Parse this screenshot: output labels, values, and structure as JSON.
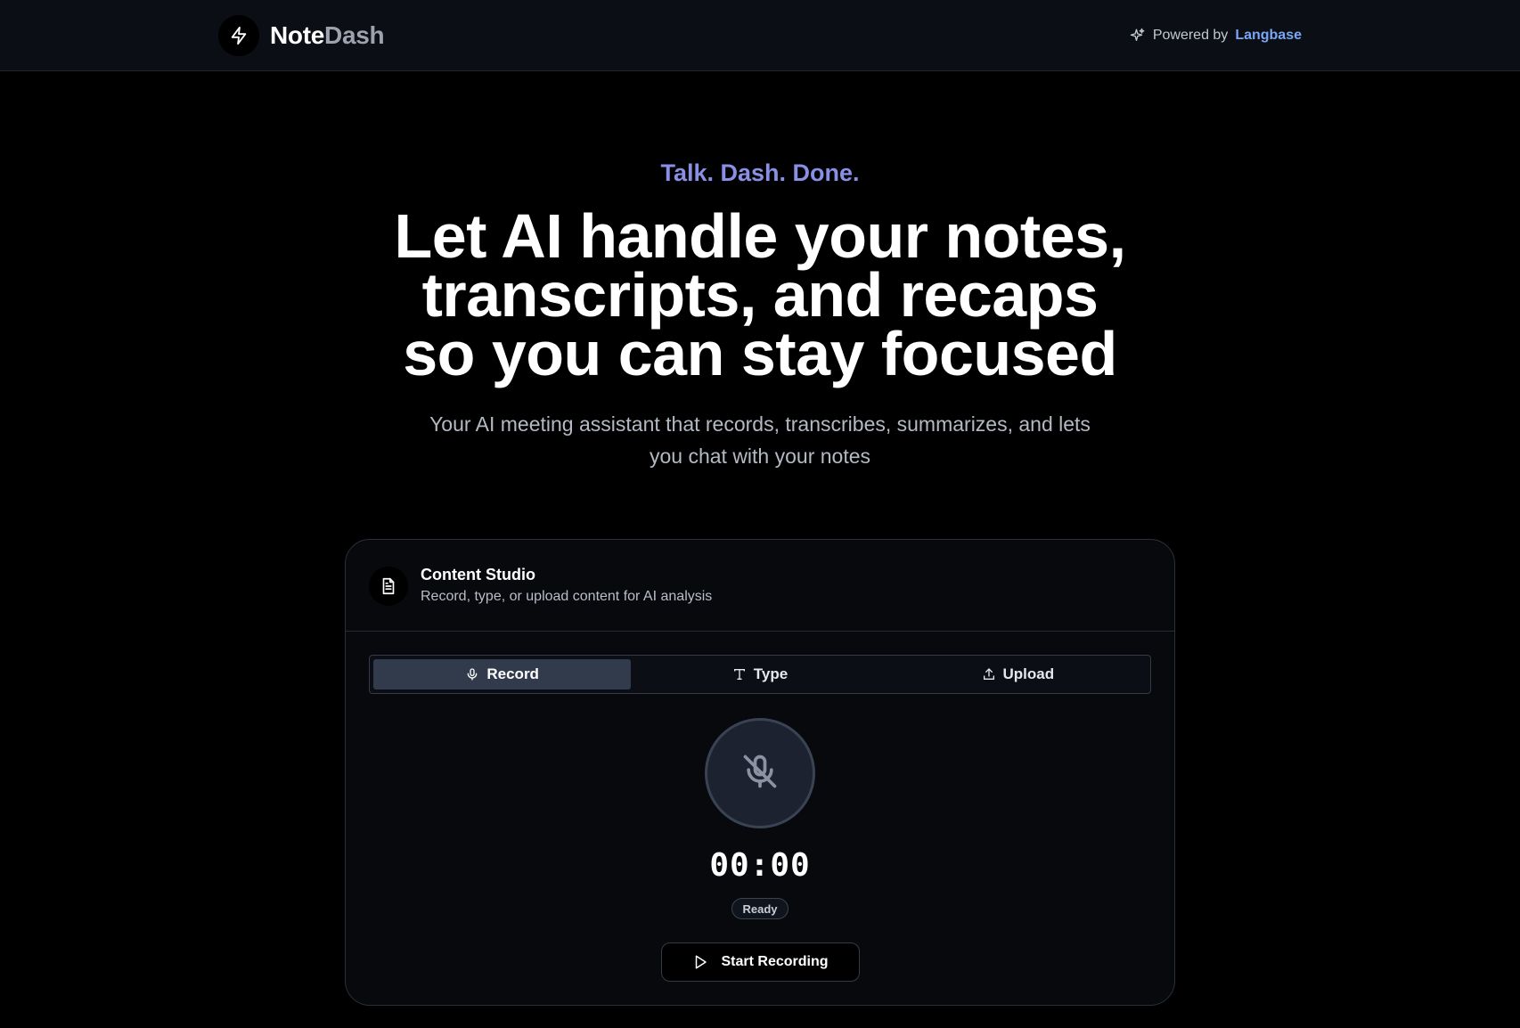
{
  "header": {
    "brand_primary": "Note",
    "brand_secondary": "Dash",
    "logo_icon": "bolt-icon",
    "powered_label": "Powered by",
    "powered_link": "Langbase",
    "powered_icon": "sparkles-icon"
  },
  "hero": {
    "tagline": "Talk. Dash. Done.",
    "headline_lines": [
      "Let AI handle your notes,",
      "transcripts, and recaps",
      "so you can stay focused"
    ],
    "subtitle": "Your AI meeting assistant that records, transcribes, summarizes, and lets you chat with your notes"
  },
  "studio": {
    "icon": "document-icon",
    "title": "Content Studio",
    "subtitle": "Record, type, or upload content for AI analysis",
    "tabs": [
      {
        "label": "Record",
        "icon": "microphone-icon",
        "active": true
      },
      {
        "label": "Type",
        "icon": "text-icon",
        "active": false
      },
      {
        "label": "Upload",
        "icon": "upload-icon",
        "active": false
      }
    ],
    "mic_icon": "microphone-off-icon",
    "timer": "00:00",
    "status": "Ready",
    "start_button": "Start Recording",
    "start_icon": "play-icon"
  },
  "colors": {
    "background": "#000000",
    "navbar": "#0b0e14",
    "tagline": "#8a8fe6",
    "link": "#7aa7f5",
    "active_tab": "#323b4c"
  }
}
